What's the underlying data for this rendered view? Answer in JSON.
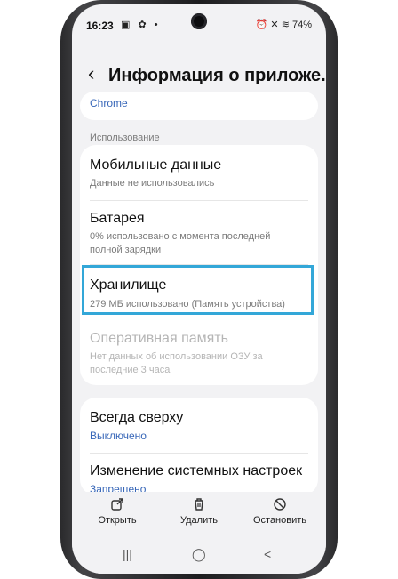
{
  "status_bar": {
    "time": "16:23",
    "left_icons": "▣ ✿ •",
    "right_text": "⏰ ✕ ≋ 74%"
  },
  "header": {
    "title": "Информация о приложе..."
  },
  "top_card": {
    "partial_value": "Chrome"
  },
  "section_usage": {
    "label": "Использование"
  },
  "usage_items": [
    {
      "title": "Мобильные данные",
      "subtitle": "Данные не использовались"
    },
    {
      "title": "Батарея",
      "subtitle_line1": "0% использовано с момента последней",
      "subtitle_line2": "полной зарядки"
    },
    {
      "title": "Хранилище",
      "subtitle": "279 МБ использовано (Память устройства)"
    },
    {
      "title": "Оперативная память",
      "subtitle_line1": "Нет данных об использовании ОЗУ за",
      "subtitle_line2": "последние 3 часа"
    }
  ],
  "advanced_items": [
    {
      "title": "Всегда сверху",
      "subtitle": "Выключено"
    },
    {
      "title": "Изменение системных настроек",
      "subtitle": "Запрещено"
    }
  ],
  "bottom_actions": [
    {
      "label": "Открыть",
      "icon": "open-external-icon"
    },
    {
      "label": "Удалить",
      "icon": "trash-icon"
    },
    {
      "label": "Остановить",
      "icon": "stop-icon"
    }
  ],
  "nav_bar": {
    "recents": "|||",
    "home": "◯",
    "back": "<"
  },
  "colors": {
    "accent_blue": "#3867b8",
    "highlight_border": "#33a7d8",
    "background": "#f2f2f4"
  }
}
